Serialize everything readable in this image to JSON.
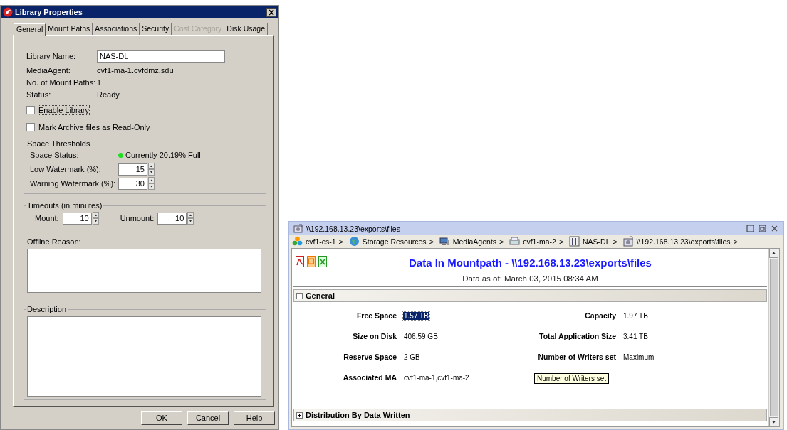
{
  "dialog": {
    "title": "Library Properties",
    "tabs": [
      {
        "label": "General",
        "selected": true,
        "disabled": false
      },
      {
        "label": "Mount Paths",
        "selected": false,
        "disabled": false
      },
      {
        "label": "Associations",
        "selected": false,
        "disabled": false
      },
      {
        "label": "Security",
        "selected": false,
        "disabled": false
      },
      {
        "label": "Cost Category",
        "selected": false,
        "disabled": true
      },
      {
        "label": "Disk Usage",
        "selected": false,
        "disabled": false
      }
    ],
    "fields": [
      {
        "label": "Library Name:",
        "kind": "input",
        "value": "NAS-DL"
      },
      {
        "label": "MediaAgent:",
        "kind": "text",
        "value": "cvf1-ma-1.cvfdmz.sdu"
      },
      {
        "label": "No. of Mount Paths:",
        "kind": "text",
        "value": "1"
      },
      {
        "label": "Status:",
        "kind": "text",
        "value": "Ready"
      }
    ],
    "checkboxes": [
      {
        "label": "Enable Library",
        "checked": false,
        "focused": true
      },
      {
        "label": "Mark Archive files as Read-Only",
        "checked": false,
        "focused": false
      }
    ],
    "space_thresholds": {
      "title": "Space Thresholds",
      "status": [
        {
          "label": "Space Status:",
          "text": "Currently 20.19% Full",
          "color": "#22dd22"
        }
      ],
      "spinners": [
        {
          "label": "Low Watermark (%):",
          "value": "15"
        },
        {
          "label": "Warning Watermark (%):",
          "value": "30"
        }
      ]
    },
    "timeouts": {
      "title": "Timeouts (in minutes)",
      "spinners": [
        {
          "label": "Mount:",
          "value": "10"
        },
        {
          "label": "Unmount:",
          "value": "10"
        }
      ]
    },
    "offline_reason": {
      "title": "Offline Reason:"
    },
    "description": {
      "title": "Description"
    },
    "buttons": [
      "OK",
      "Cancel",
      "Help"
    ]
  },
  "panel": {
    "title": "\\\\192.168.13.23\\exports\\files",
    "breadcrumb": [
      {
        "label": "cvf1-cs-1",
        "kind": "commcell",
        "arrow": ">"
      },
      {
        "label": "Storage Resources",
        "kind": "globe",
        "arrow": ">"
      },
      {
        "label": "MediaAgents",
        "kind": "computer",
        "arrow": ">"
      },
      {
        "label": "cvf1-ma-2",
        "kind": "server",
        "arrow": ">"
      },
      {
        "label": "NAS-DL",
        "kind": "library",
        "arrow": ">"
      },
      {
        "label": "\\\\192.168.13.23\\exports\\files",
        "kind": "mountpath",
        "arrow": ">"
      }
    ],
    "report": {
      "title": "Data In Mountpath - \\\\192.168.13.23\\exports\\files",
      "subtitle": "Data as of: March 03, 2015 08:34 AM",
      "sections": [
        {
          "title": "General",
          "expanded": true,
          "properties": [
            {
              "label": "Free Space",
              "value": "1.57 TB",
              "selected": true
            },
            {
              "label": "Capacity",
              "value": "1.97 TB",
              "selected": false
            },
            {
              "label": "Size on Disk",
              "value": "406.59 GB",
              "selected": false
            },
            {
              "label": "Total Application Size",
              "value": "3.41 TB",
              "selected": false
            },
            {
              "label": "Reserve Space",
              "value": "2 GB",
              "selected": false
            },
            {
              "label": "Number of Writers set",
              "value": "Maximum",
              "selected": false
            },
            {
              "label": "Associated MA",
              "value": "cvf1-ma-1,cvf1-ma-2",
              "selected": false
            }
          ]
        },
        {
          "title": "Distribution By Data Written",
          "expanded": false
        }
      ]
    },
    "tooltip": "Number of Writers set"
  }
}
